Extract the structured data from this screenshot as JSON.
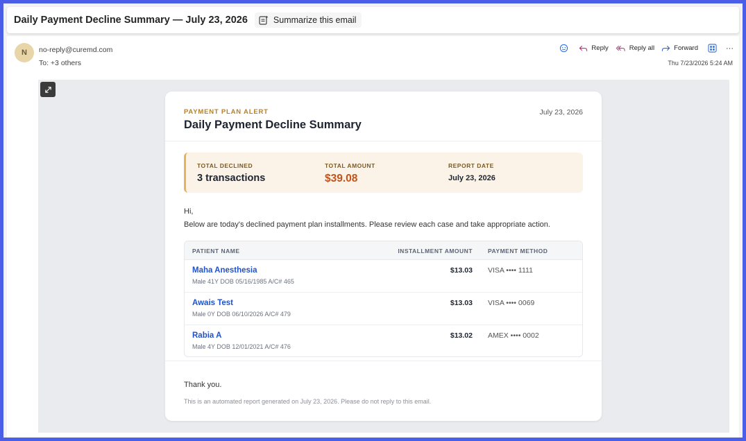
{
  "subject": {
    "title": "Daily Payment Decline Summary — July 23, 2026",
    "summarize_label": "Summarize this email"
  },
  "header": {
    "avatar_initial": "N",
    "from": "no-reply@curemd.com",
    "to": "To:  +3 others",
    "timestamp": "Thu 7/23/2026 5:24 AM",
    "reply_label": "Reply",
    "reply_all_label": "Reply all",
    "forward_label": "Forward",
    "more_label": "···"
  },
  "email": {
    "alert_label": "PAYMENT PLAN ALERT",
    "date": "July 23, 2026",
    "title": "Daily Payment Decline Summary",
    "summary": {
      "total_declined_label": "TOTAL DECLINED",
      "total_declined_value": "3 transactions",
      "total_amount_label": "TOTAL AMOUNT",
      "total_amount_value": "$39.08",
      "report_date_label": "REPORT DATE",
      "report_date_value": "July 23, 2026"
    },
    "greeting": "Hi,",
    "intro": "Below are today's declined payment plan installments. Please review each case and take appropriate action.",
    "table": {
      "headers": [
        "PATIENT NAME",
        "INSTALLMENT AMOUNT",
        "PAYMENT METHOD"
      ],
      "rows": [
        {
          "name": "Maha Anesthesia",
          "meta": "Male  41Y  DOB 05/16/1985  A/C# 465",
          "amount": "$13.03",
          "method": "VISA •••• 1111"
        },
        {
          "name": "Awais Test",
          "meta": "Male  0Y  DOB 06/10/2026  A/C# 479",
          "amount": "$13.03",
          "method": "VISA •••• 0069"
        },
        {
          "name": "Rabia A",
          "meta": "Male  4Y  DOB 12/01/2021  A/C# 476",
          "amount": "$13.02",
          "method": "AMEX •••• 0002"
        }
      ]
    },
    "thanks": "Thank you.",
    "footer": "This is an automated report generated on July 23, 2026. Please do not reply to this email."
  },
  "colors": {
    "frame": "#4a5ee8",
    "accent_link": "#1f52c9",
    "amount": "#c2531a",
    "alert": "#b5812a",
    "summary_bg": "#fbf3e7"
  }
}
